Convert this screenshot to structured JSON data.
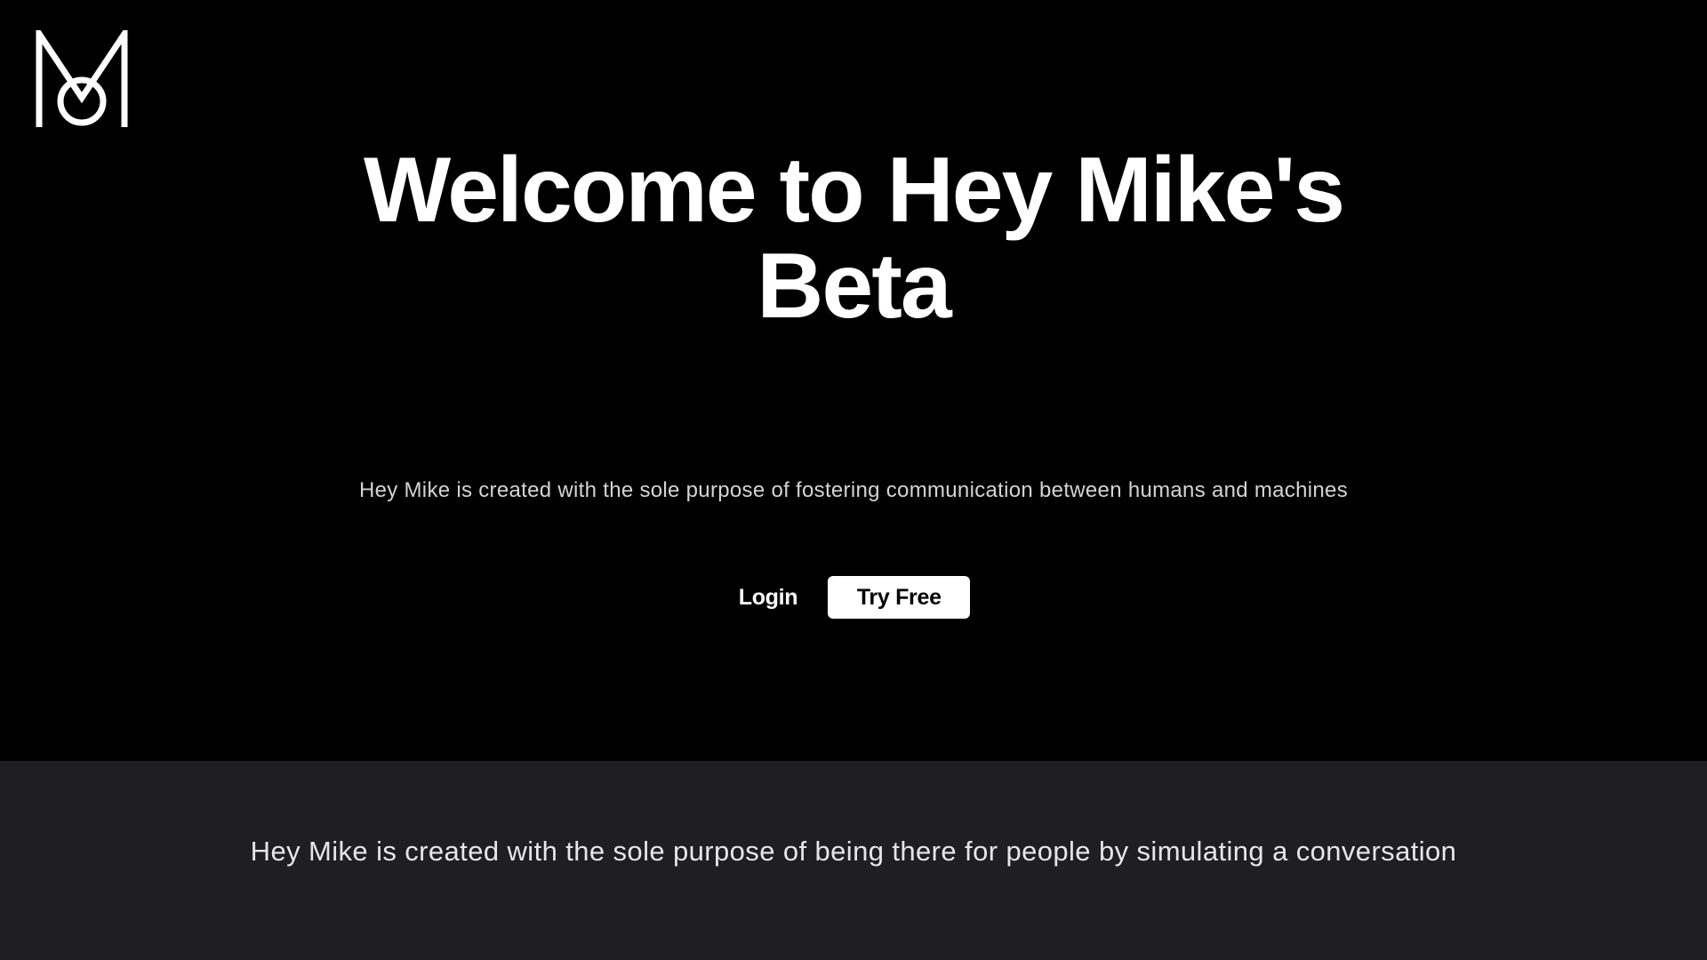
{
  "brand": {
    "logo_icon": "m-monogram-logo",
    "logo_color": "#ffffff"
  },
  "hero": {
    "title_line1": "Welcome to Hey Mike's",
    "title_line2": "Beta",
    "subtitle": "Hey Mike is created with the sole purpose of fostering communication between humans and machines",
    "login_label": "Login",
    "try_free_label": "Try Free",
    "background": "#000000"
  },
  "info": {
    "text": "Hey Mike is created with the sole purpose of being there for people by simulating a conversation",
    "background": "#1f1f21"
  }
}
